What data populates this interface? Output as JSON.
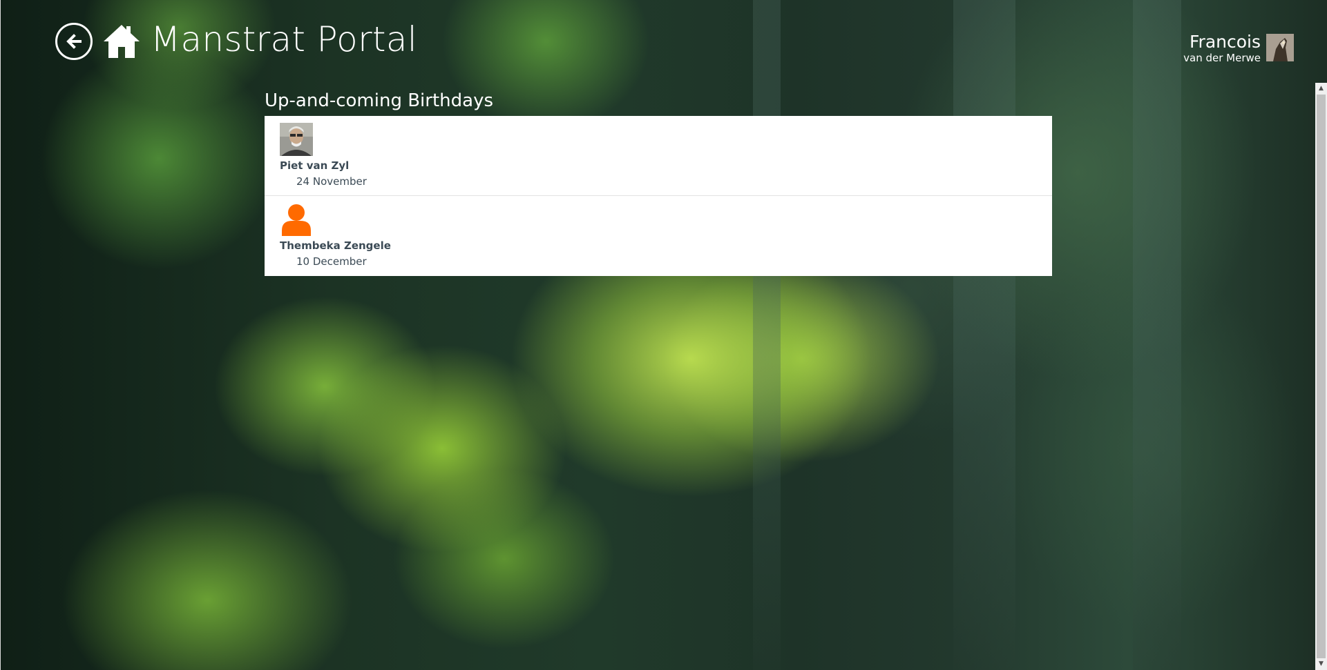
{
  "header": {
    "app_title": "Manstrat Portal",
    "back_icon": "back-arrow-icon",
    "home_icon": "home-icon"
  },
  "user": {
    "first_name": "Francois",
    "last_name": "van der Merwe",
    "avatar_icon": "user-avatar-image"
  },
  "birthdays": {
    "title": "Up-and-coming Birthdays",
    "items": [
      {
        "name": "Piet van Zyl",
        "date": "24 November",
        "avatar": "photo"
      },
      {
        "name": "Thembeka Zengele",
        "date": "10 December",
        "avatar": "placeholder-person-icon"
      }
    ]
  },
  "colors": {
    "placeholder_avatar": "#ff6a00",
    "list_text": "#3b4a55",
    "header_text": "#ffffff"
  }
}
